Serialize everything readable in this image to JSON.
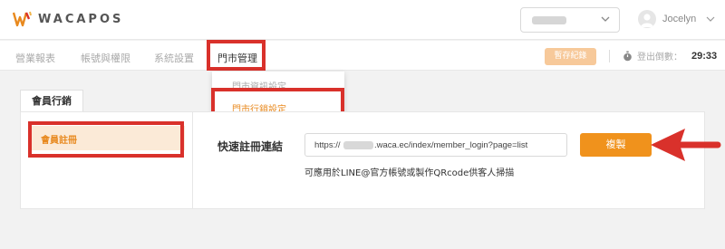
{
  "header": {
    "logo_text": "WACAPOS",
    "user_name": "Jocelyn"
  },
  "nav": {
    "items": [
      "營業報表",
      "帳號與權限",
      "系統設置",
      "門市管理"
    ],
    "record_button": "暫存紀錄",
    "logout_countdown_label": "登出倒數：",
    "logout_countdown_value": "29:33"
  },
  "dropdown": {
    "items": [
      "門市資訊設定",
      "門市行銷設定"
    ]
  },
  "tabs": [
    "會員行銷"
  ],
  "sidebar": {
    "items": [
      "會員註冊"
    ]
  },
  "main": {
    "link_label": "快速註冊連結",
    "link_prefix": "https://",
    "link_rest": ".waca.ec/index/member_login?page=list",
    "copy_button": "複製",
    "hint": "可應用於LINE@官方帳號或製作QRcode供客人掃描"
  },
  "colors": {
    "accent": "#f0921c",
    "highlight": "#d9312b",
    "active_bg": "#fbead7"
  }
}
